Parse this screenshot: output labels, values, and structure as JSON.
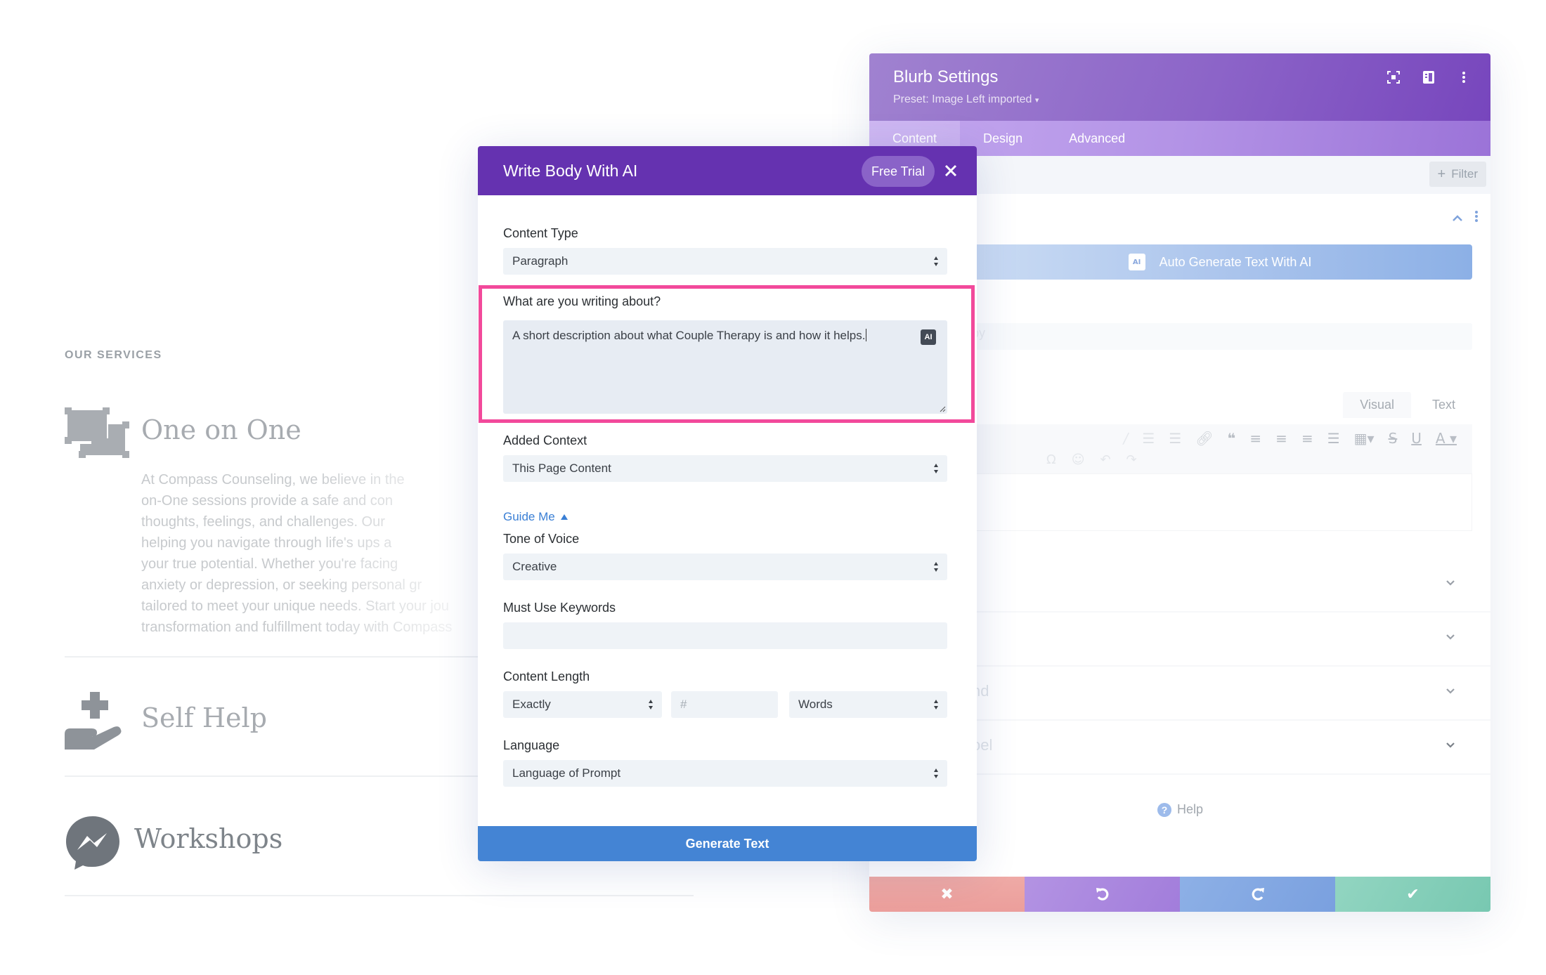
{
  "page": {
    "eyebrow": "OUR SERVICES",
    "services": [
      {
        "title": "One on One",
        "icon": "frames-icon",
        "description": "At Compass Counseling, we believe in the\non-One sessions provide a safe and con\nthoughts, feelings, and challenges. Our\nhelping you navigate through life's ups a\nyour true potential. Whether you're facing\nanxiety or depression, or seeking personal gr\ntailored to meet your unique needs. Start your jou\ntransformation and fulfillment today with Compass"
      },
      {
        "title": "Self Help",
        "icon": "hand-cross-icon"
      },
      {
        "title": "Workshops",
        "icon": "messenger-icon"
      }
    ]
  },
  "blurb": {
    "title": "Blurb Settings",
    "preset": "Preset: Image Left imported",
    "preset_caret": "▾",
    "tabs": [
      {
        "label": "Content",
        "active": true
      },
      {
        "label": "Design",
        "active": false
      },
      {
        "label": "Advanced",
        "active": false
      }
    ],
    "filter_label": "Filter",
    "auto_generate_label": "Auto Generate Text With AI",
    "ai_chip": "AI",
    "ghost_body_fragment": "py",
    "editor_tabs": [
      "Visual",
      "Text"
    ],
    "accordion_fragments": [
      "",
      "",
      "nd",
      "oel"
    ],
    "help_label": "Help",
    "colors": {
      "discard": "#eda5a2",
      "undo": "#a98add",
      "redo": "#84a9e2",
      "save": "#81cfb8"
    }
  },
  "modal": {
    "title": "Write Body With AI",
    "free_trial": "Free Trial",
    "fields": {
      "content_type": {
        "label": "Content Type",
        "value": "Paragraph"
      },
      "topic": {
        "label": "What are you writing about?",
        "value": "A short description about what Couple Therapy is and how it helps.",
        "ai_badge": "AI"
      },
      "added_context": {
        "label": "Added Context",
        "value": "This Page Content"
      },
      "guide_me": "Guide Me",
      "tone": {
        "label": "Tone of Voice",
        "value": "Creative"
      },
      "keywords": {
        "label": "Must Use Keywords",
        "value": ""
      },
      "content_length": {
        "label": "Content Length",
        "mode": "Exactly",
        "number_placeholder": "#",
        "unit": "Words"
      },
      "language": {
        "label": "Language",
        "value": "Language of Prompt"
      }
    },
    "generate_label": "Generate Text",
    "colors": {
      "header": "#6532b0",
      "highlight": "#f2499b",
      "generate": "#4484d4",
      "link": "#3a7fd5"
    }
  }
}
